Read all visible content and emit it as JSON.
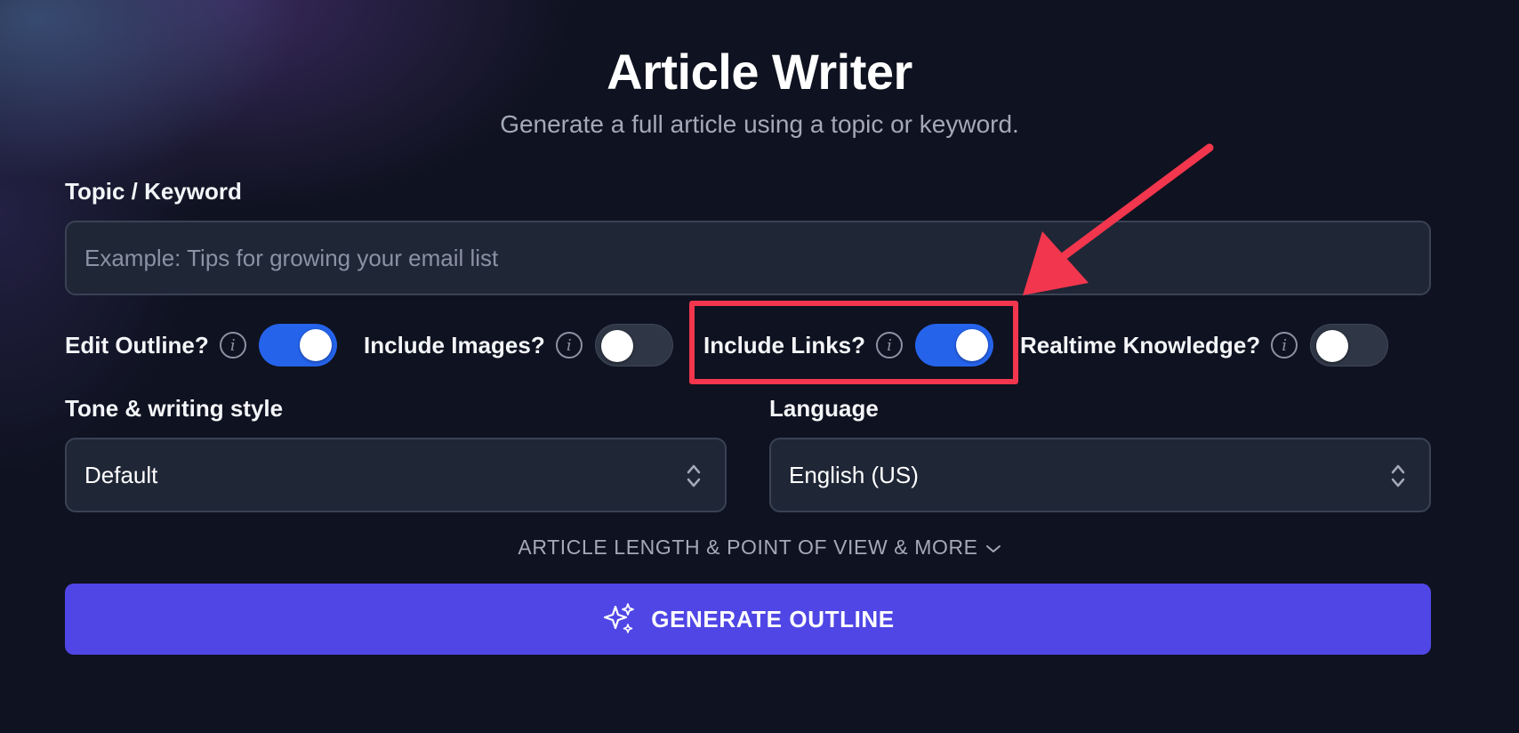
{
  "header": {
    "title": "Article Writer",
    "subtitle": "Generate a full article using a topic or keyword."
  },
  "topic": {
    "label": "Topic / Keyword",
    "placeholder": "Example: Tips for growing your email list",
    "value": ""
  },
  "toggles": [
    {
      "label": "Edit Outline?",
      "state": "on"
    },
    {
      "label": "Include Images?",
      "state": "off"
    },
    {
      "label": "Include Links?",
      "state": "on"
    },
    {
      "label": "Realtime Knowledge?",
      "state": "off"
    }
  ],
  "tone": {
    "label": "Tone & writing style",
    "value": "Default"
  },
  "language": {
    "label": "Language",
    "value": "English (US)"
  },
  "more_options": {
    "label": "ARTICLE LENGTH & POINT OF VIEW & MORE"
  },
  "generate": {
    "label": "GENERATE OUTLINE",
    "icon": "sparkles-icon"
  },
  "annotation": {
    "color": "#f2364d",
    "target": "Include Links?"
  },
  "colors": {
    "accent": "#4f46e5",
    "toggle_on": "#2563eb",
    "background": "#0f1220"
  }
}
